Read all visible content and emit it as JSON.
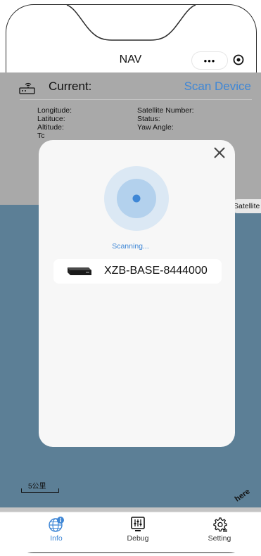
{
  "header": {
    "title": "NAV",
    "capsule_dots": "•••"
  },
  "current": {
    "label": "Current:",
    "scan_button": "Scan Device"
  },
  "info": {
    "longitude_label": "Longitude:",
    "latitude_label": "Latituce:",
    "altitude_label": "Altitude:",
    "partial_label": "Tc",
    "satellite_number_label": "Satellite Number:",
    "status_label": "Status:",
    "yaw_angle_label": "Yaw Angle:"
  },
  "map": {
    "scale_label": "5公里",
    "satellite_toggle": "Satellite",
    "attribution": "here"
  },
  "modal": {
    "status": "Scanning...",
    "devices": [
      {
        "name": "XZB-BASE-8444000"
      }
    ]
  },
  "tabs": [
    {
      "label": "Info",
      "icon": "globe-info-icon",
      "active": true
    },
    {
      "label": "Debug",
      "icon": "debug-sliders-icon",
      "active": false
    },
    {
      "label": "Setting",
      "icon": "gear-icon",
      "active": false
    }
  ],
  "colors": {
    "accent": "#3f87d6",
    "map": "#5c7f96",
    "panel": "#a9a9a9"
  }
}
